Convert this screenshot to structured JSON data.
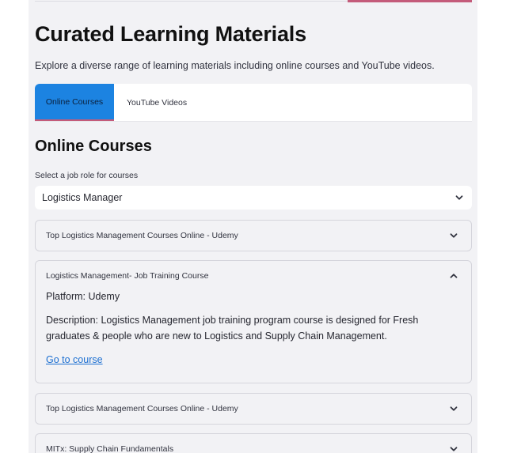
{
  "page": {
    "title": "Curated Learning Materials",
    "subtitle": "Explore a diverse range of learning materials including online courses and YouTube videos."
  },
  "tabs": [
    {
      "label": "Online Courses",
      "active": true
    },
    {
      "label": "YouTube Videos",
      "active": false
    }
  ],
  "section": {
    "title": "Online Courses",
    "select_label": "Select a job role for courses",
    "select_value": "Logistics Manager"
  },
  "courses": [
    {
      "title": "Top Logistics Management Courses Online - Udemy",
      "expanded": false
    },
    {
      "title": "Logistics Management- Job Training Course",
      "expanded": true,
      "platform": "Platform: Udemy",
      "description": "Description: Logistics Management job training program course is designed for Fresh graduates & people who are new to Logistics and Supply Chain Management.",
      "link_label": "Go to course"
    },
    {
      "title": "Top Logistics Management Courses Online - Udemy",
      "expanded": false
    },
    {
      "title": "MITx: Supply Chain Fundamentals",
      "expanded": false
    }
  ],
  "colors": {
    "accent": "#1c83e1",
    "tab_underline": "#c45b7a",
    "link": "#1c6fd1"
  }
}
